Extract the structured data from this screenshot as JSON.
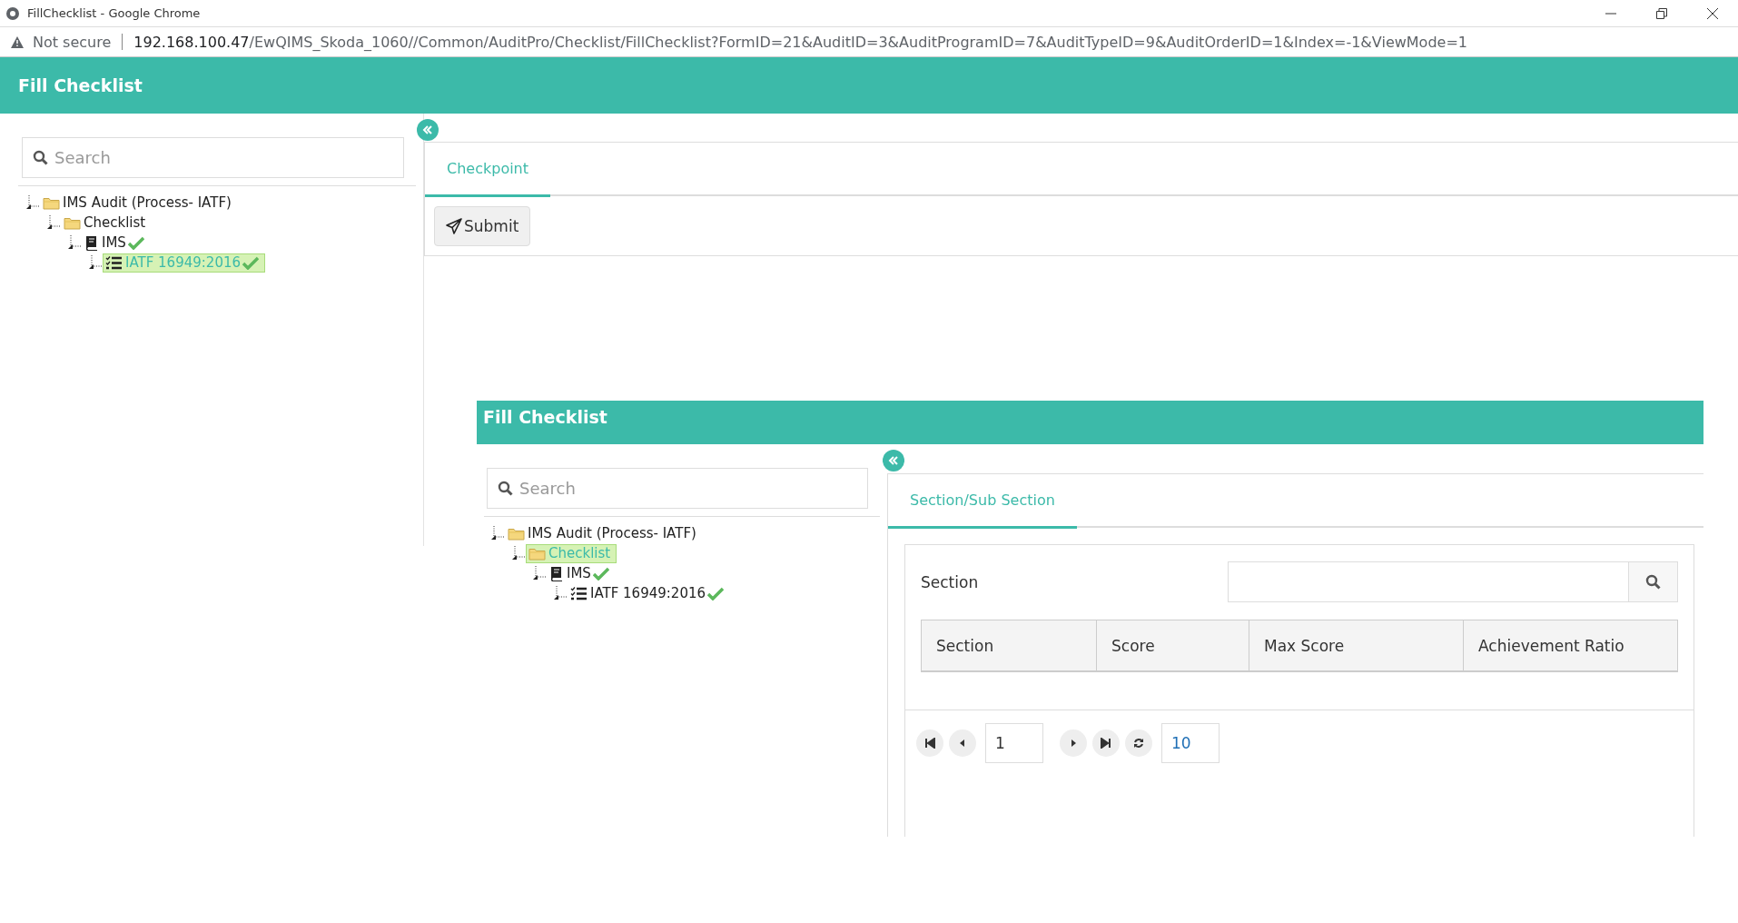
{
  "browser": {
    "tab_title": "FillChecklist - Google Chrome",
    "security": "Not secure",
    "url_host": "192.168.100.47",
    "url_path": "/EwQIMS_Skoda_1060//Common/AuditPro/Checklist/FillChecklist?FormID=21&AuditID=3&AuditProgramID=7&AuditTypeID=9&AuditOrderID=1&Index=-1&ViewMode=1"
  },
  "header": {
    "title": "Fill Checklist"
  },
  "sidebar": {
    "search": {
      "placeholder": "Search"
    },
    "tree": [
      {
        "label": "IMS Audit (Process- IATF)",
        "kind": "folder",
        "selected": false,
        "checked": false,
        "children": [
          {
            "label": "Checklist",
            "kind": "folder",
            "selected": false,
            "checked": false,
            "children": [
              {
                "label": "IMS",
                "kind": "book",
                "selected": false,
                "checked": true,
                "children": [
                  {
                    "label": "IATF 16949:2016",
                    "kind": "checklist",
                    "selected": true,
                    "checked": true
                  }
                ]
              }
            ]
          }
        ]
      }
    ]
  },
  "tabs": [
    {
      "label": "Checkpoint",
      "selected": true
    }
  ],
  "toolbar": {
    "buttons": [
      "Submit"
    ]
  },
  "embedded": {
    "header": {
      "title": "Fill Checklist"
    },
    "sidebar": {
      "search": {
        "placeholder": "Search"
      },
      "tree": [
        {
          "label": "IMS Audit (Process- IATF)",
          "kind": "folder",
          "selected": false,
          "checked": false,
          "children": [
            {
              "label": "Checklist",
              "kind": "folder",
              "selected": true,
              "checked": false,
              "children": [
                {
                  "label": "IMS",
                  "kind": "book",
                  "selected": false,
                  "checked": true,
                  "children": [
                    {
                      "label": "IATF 16949:2016",
                      "kind": "checklist",
                      "selected": false,
                      "checked": true
                    }
                  ]
                }
              ]
            }
          ]
        }
      ]
    },
    "tabs": [
      {
        "label": "Section/Sub Section",
        "selected": true
      }
    ],
    "filter": {
      "label": "Section"
    },
    "table": {
      "columns": [
        "Section",
        "Score",
        "Max Score",
        "Achievement Ratio"
      ]
    },
    "pager": {
      "page": "1",
      "page_size": "10"
    }
  }
}
